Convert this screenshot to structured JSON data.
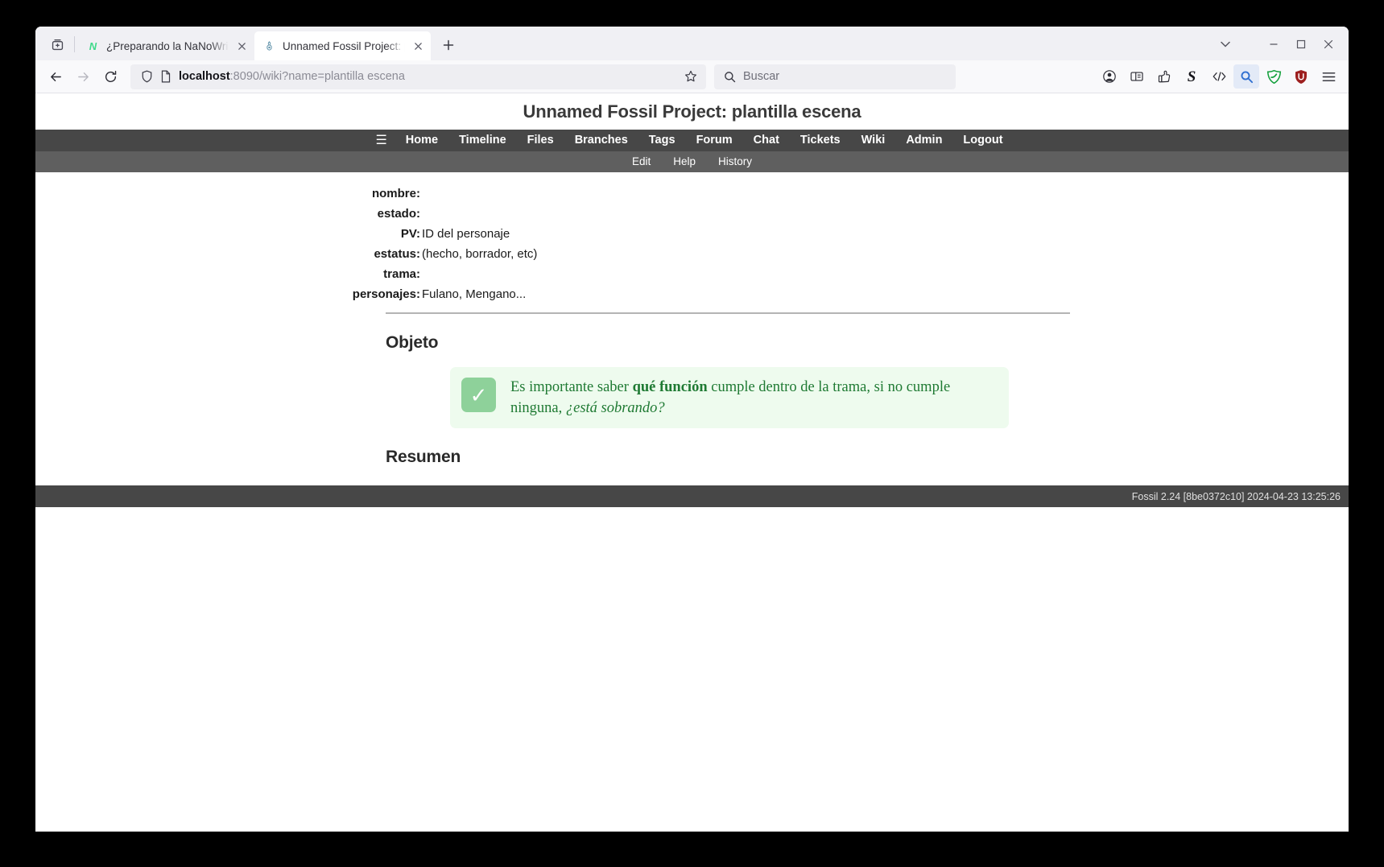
{
  "browser": {
    "tabs": [
      {
        "title": "¿Preparando la NaNoWriM",
        "favicon": "N",
        "favicon_color": "#3fd98a",
        "active": false,
        "close_label": "✕"
      },
      {
        "title": "Unnamed Fossil Project: pl",
        "favicon": "fossil-icon",
        "active": true,
        "close_label": "✕"
      }
    ],
    "new_tab_label": "+",
    "tab_list_label": "⌄",
    "window_controls": {
      "minimize": "—",
      "maximize": "▢",
      "close": "✕"
    },
    "nav": {
      "back": "←",
      "forward": "→",
      "reload": "⟳"
    },
    "url": {
      "host": "localhost",
      "rest": ":8090/wiki?name=plantilla escena"
    },
    "search": {
      "placeholder": "Buscar"
    },
    "toolbar_icons": [
      "account-icon",
      "reader-view-icon",
      "extension-save-icon",
      "stylus-icon",
      "code-view-icon",
      "search-magnifier-icon",
      "shield-green-icon",
      "ublock-origin-icon",
      "app-menu-icon"
    ]
  },
  "fossil": {
    "title": "Unnamed Fossil Project: plantilla escena",
    "mainmenu": [
      "Home",
      "Timeline",
      "Files",
      "Branches",
      "Tags",
      "Forum",
      "Chat",
      "Tickets",
      "Wiki",
      "Admin",
      "Logout"
    ],
    "hamburger": "☰",
    "submenu": [
      "Edit",
      "Help",
      "History"
    ],
    "deflist": [
      {
        "term": "nombre",
        "value": ""
      },
      {
        "term": "estado",
        "value": ""
      },
      {
        "term": "PV",
        "value": "ID del personaje"
      },
      {
        "term": "estatus",
        "value": "(hecho, borrador, etc)"
      },
      {
        "term": "trama",
        "value": ""
      },
      {
        "term": "personajes",
        "value": "Fulano, Mengano..."
      }
    ],
    "separator": ":",
    "sections": [
      {
        "heading": "Objeto"
      },
      {
        "heading": "Resumen"
      }
    ],
    "callout": {
      "badge": "✓",
      "text_before": "Es importante saber ",
      "text_bold": "qué función",
      "text_middle": " cumple dentro de la trama, si no cumple ninguna, ",
      "text_italic": "¿está sobrando?"
    },
    "footer": "Fossil 2.24 [8be0372c10] 2024-04-23 13:25:26"
  },
  "colors": {
    "nav_bar": "#474747",
    "sub_nav": "#5f5f5f",
    "callout_bg": "#eefbee",
    "callout_badge": "#8ed19a",
    "callout_text": "#1f7a33"
  }
}
